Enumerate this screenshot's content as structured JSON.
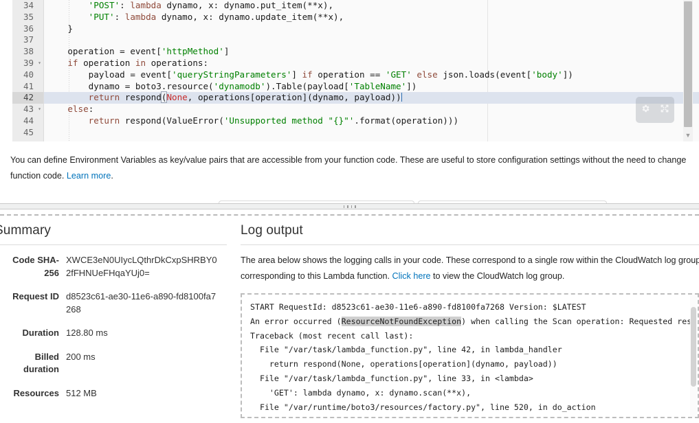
{
  "editor": {
    "lines": [
      {
        "num": "34",
        "fold": false,
        "active": false,
        "segments": [
          {
            "t": "        ",
            "c": "plain"
          },
          {
            "t": "'POST'",
            "c": "str"
          },
          {
            "t": ": ",
            "c": "plain"
          },
          {
            "t": "lambda",
            "c": "kw"
          },
          {
            "t": " dynamo, x: dynamo.put_item(**x),",
            "c": "plain"
          }
        ]
      },
      {
        "num": "35",
        "fold": false,
        "active": false,
        "segments": [
          {
            "t": "        ",
            "c": "plain"
          },
          {
            "t": "'PUT'",
            "c": "str"
          },
          {
            "t": ": ",
            "c": "plain"
          },
          {
            "t": "lambda",
            "c": "kw"
          },
          {
            "t": " dynamo, x: dynamo.update_item(**x),",
            "c": "plain"
          }
        ]
      },
      {
        "num": "36",
        "fold": false,
        "active": false,
        "segments": [
          {
            "t": "    }",
            "c": "plain"
          }
        ]
      },
      {
        "num": "37",
        "fold": false,
        "active": false,
        "segments": []
      },
      {
        "num": "38",
        "fold": false,
        "active": false,
        "segments": [
          {
            "t": "    operation = event[",
            "c": "plain"
          },
          {
            "t": "'httpMethod'",
            "c": "str"
          },
          {
            "t": "]",
            "c": "plain"
          }
        ]
      },
      {
        "num": "39",
        "fold": true,
        "active": false,
        "segments": [
          {
            "t": "    ",
            "c": "plain"
          },
          {
            "t": "if",
            "c": "kw"
          },
          {
            "t": " operation ",
            "c": "plain"
          },
          {
            "t": "in",
            "c": "kw"
          },
          {
            "t": " operations:",
            "c": "plain"
          }
        ]
      },
      {
        "num": "40",
        "fold": false,
        "active": false,
        "segments": [
          {
            "t": "        payload = event[",
            "c": "plain"
          },
          {
            "t": "'queryStringParameters'",
            "c": "str"
          },
          {
            "t": "] ",
            "c": "plain"
          },
          {
            "t": "if",
            "c": "kw"
          },
          {
            "t": " operation == ",
            "c": "plain"
          },
          {
            "t": "'GET'",
            "c": "str"
          },
          {
            "t": " ",
            "c": "plain"
          },
          {
            "t": "else",
            "c": "kw"
          },
          {
            "t": " json.loads(event[",
            "c": "plain"
          },
          {
            "t": "'body'",
            "c": "str"
          },
          {
            "t": "])",
            "c": "plain"
          }
        ]
      },
      {
        "num": "41",
        "fold": false,
        "active": false,
        "segments": [
          {
            "t": "        dynamo = boto3.resource(",
            "c": "plain"
          },
          {
            "t": "'dynamodb'",
            "c": "str"
          },
          {
            "t": ").Table(payload[",
            "c": "plain"
          },
          {
            "t": "'TableName'",
            "c": "str"
          },
          {
            "t": "])",
            "c": "plain"
          }
        ]
      },
      {
        "num": "42",
        "fold": false,
        "active": true,
        "segments": [
          {
            "t": "        ",
            "c": "plain"
          },
          {
            "t": "return",
            "c": "kw"
          },
          {
            "t": " respond",
            "c": "plain"
          },
          {
            "t": "(",
            "c": "paren"
          },
          {
            "t": "None",
            "c": "const"
          },
          {
            "t": ", operations[operation](dynamo, payload))",
            "c": "plain"
          },
          {
            "t": "",
            "c": "cursor"
          }
        ]
      },
      {
        "num": "43",
        "fold": true,
        "active": false,
        "segments": [
          {
            "t": "    ",
            "c": "plain"
          },
          {
            "t": "else",
            "c": "kw"
          },
          {
            "t": ":",
            "c": "plain"
          }
        ]
      },
      {
        "num": "44",
        "fold": false,
        "active": false,
        "segments": [
          {
            "t": "        ",
            "c": "plain"
          },
          {
            "t": "return",
            "c": "kw"
          },
          {
            "t": " respond(ValueError(",
            "c": "plain"
          },
          {
            "t": "'Unsupported method \"{}\"'",
            "c": "str"
          },
          {
            "t": ".format(operation)))",
            "c": "plain"
          }
        ]
      },
      {
        "num": "45",
        "fold": false,
        "active": false,
        "segments": []
      }
    ],
    "toolbar": {
      "settings_icon": "gear-icon",
      "fullscreen_icon": "expand-icon"
    },
    "scrollbar_down_glyph": "▼"
  },
  "env_vars": {
    "text_before_link": "You can define Environment Variables as key/value pairs that are accessible from your function code. These are useful to store configuration settings without the need to change function code. ",
    "link_label": "Learn more",
    "text_after_link": "."
  },
  "summary": {
    "title": "Summary",
    "rows": [
      {
        "label": "Code SHA-256",
        "value": "XWCE3eN0UIycLQthrDkCxpSHRBY02fFHNUeFHqaYUj0="
      },
      {
        "label": "Request ID",
        "value": "d8523c61-ae30-11e6-a890-fd8100fa7268"
      },
      {
        "label": "Duration",
        "value": "128.80 ms"
      },
      {
        "label": "Billed duration",
        "value": "200 ms"
      },
      {
        "label": "Resources",
        "value": "512 MB"
      }
    ]
  },
  "log_output": {
    "title": "Log output",
    "desc_part1": "The area below shows the logging calls in your code. These correspond to a single row within the CloudWatch log group corresponding to this Lambda function. ",
    "desc_link": "Click here",
    "desc_part2": " to view the CloudWatch log group.",
    "lines": [
      {
        "pre": "START RequestId: d8523c61-ae30-11e6-a890-fd8100fa7268 Version: $LATEST",
        "hl": "",
        "post": ""
      },
      {
        "pre": "An error occurred (",
        "hl": "ResourceNotFoundException",
        "post": ") when calling the Scan operation: Requested reso"
      },
      {
        "pre": "Traceback (most recent call last):",
        "hl": "",
        "post": ""
      },
      {
        "pre": "  File \"/var/task/lambda_function.py\", line 42, in lambda_handler",
        "hl": "",
        "post": ""
      },
      {
        "pre": "    return respond(None, operations[operation](dynamo, payload))",
        "hl": "",
        "post": ""
      },
      {
        "pre": "  File \"/var/task/lambda_function.py\", line 33, in <lambda>",
        "hl": "",
        "post": ""
      },
      {
        "pre": "    'GET': lambda dynamo, x: dynamo.scan(**x),",
        "hl": "",
        "post": ""
      },
      {
        "pre": "  File \"/var/runtime/boto3/resources/factory.py\", line 520, in do_action",
        "hl": "",
        "post": ""
      }
    ]
  },
  "colors": {
    "link": "#0073bb",
    "string": "#008000",
    "keyword": "#8f4a3a",
    "constant": "#c62b2b",
    "active_line": "#dde3ee",
    "gutter": "#ececec"
  }
}
